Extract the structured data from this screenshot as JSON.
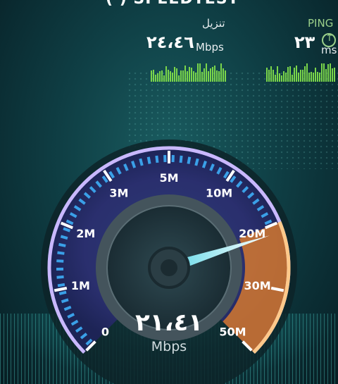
{
  "header": {
    "title": "( ) SPEEDTEST"
  },
  "download": {
    "label": "تنزيل",
    "value": "٢٤،٤٦",
    "unit": "Mbps"
  },
  "ping": {
    "label": "PING",
    "value": "٢٣",
    "unit": "ms"
  },
  "gauge": {
    "ticks": [
      "0",
      "1M",
      "2M",
      "3M",
      "5M",
      "10M",
      "20M",
      "30M",
      "50M"
    ],
    "current_speed": "٢١،٤١",
    "current_unit": "Mbps",
    "needle_value_mbps": 21.41,
    "colors": {
      "arc": "#3aa0e8",
      "glow": "#b9a6ff",
      "active": "#e08a3a"
    }
  }
}
